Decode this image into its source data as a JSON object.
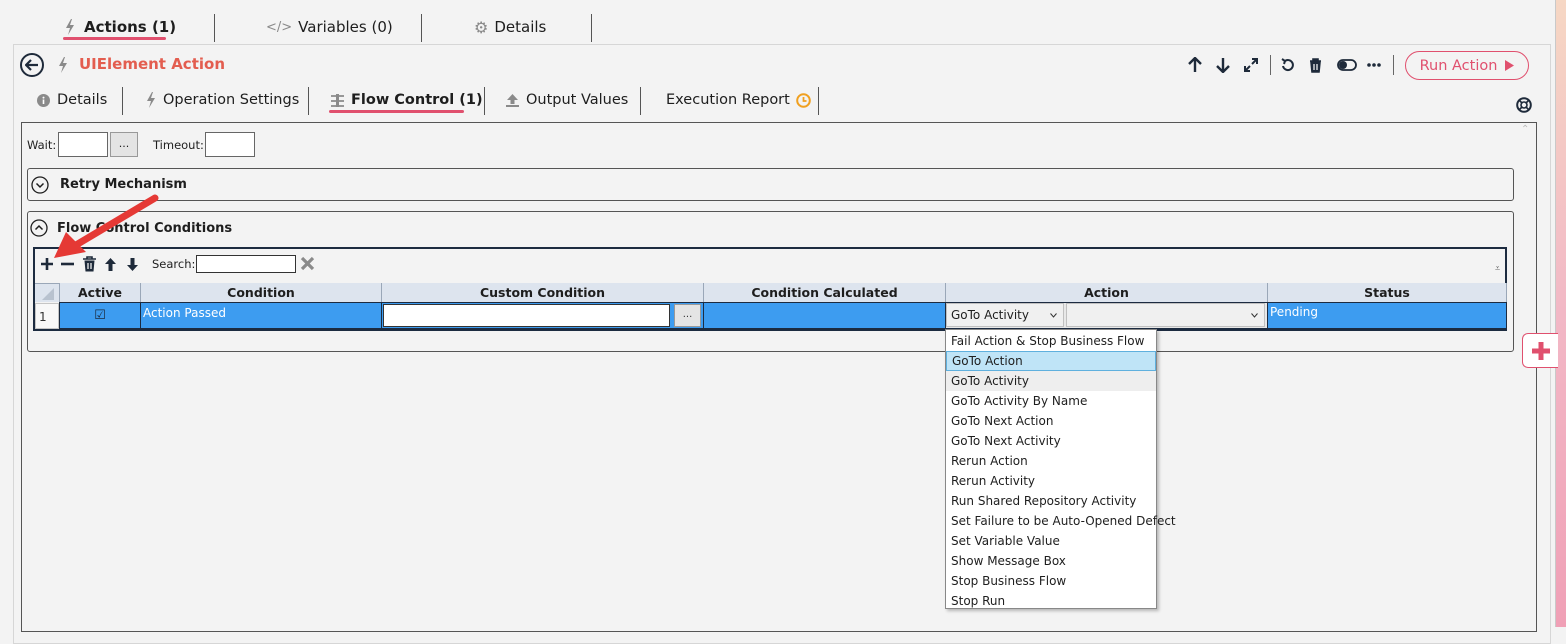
{
  "top_tabs": [
    {
      "label": "Actions (1)"
    },
    {
      "label": "Variables (0)"
    },
    {
      "label": "Details"
    }
  ],
  "header": {
    "title": "UIElement Action",
    "run_button": "Run Action"
  },
  "sub_tabs": [
    {
      "label": "Details"
    },
    {
      "label": "Operation Settings"
    },
    {
      "label": "Flow Control (1)"
    },
    {
      "label": "Output Values"
    },
    {
      "label": "Execution Report"
    }
  ],
  "wait": {
    "label": "Wait:",
    "value": "",
    "browse": "..."
  },
  "timeout": {
    "label": "Timeout:",
    "value": ""
  },
  "sections": {
    "retry": "Retry Mechanism",
    "flow": "Flow Control Conditions"
  },
  "grid": {
    "search_label": "Search:",
    "search_value": "",
    "columns": [
      "Active",
      "Condition",
      "Custom Condition",
      "Condition Calculated",
      "Action",
      "Status"
    ],
    "rows": [
      {
        "index": "1",
        "active": "☑",
        "condition": "Action Passed",
        "custom_condition": "",
        "browse": "...",
        "calculated": "",
        "action": "GoTo Activity",
        "action_value": "",
        "status": "Pending"
      }
    ]
  },
  "dropdown": {
    "options": [
      "Fail Action & Stop Business Flow",
      "GoTo Action",
      "GoTo Activity",
      "GoTo Activity By Name",
      "GoTo Next Action",
      "GoTo Next Activity",
      "Rerun Action",
      "Rerun Activity",
      "Run Shared Repository Activity",
      "Set Failure to be Auto-Opened Defect",
      "Set Variable Value",
      "Show Message Box",
      "Stop Business Flow",
      "Stop Run"
    ],
    "highlighted": "GoTo Action",
    "selected": "GoTo Activity"
  },
  "colors": {
    "accent": "#e0506e",
    "title": "#e35d4f",
    "selection": "#3d9cf0",
    "annotation_arrow": "#e53935"
  },
  "icons": [
    "lightning-icon",
    "code-icon",
    "gear-icon",
    "back-arrow-icon",
    "arrow-up-icon",
    "arrow-down-icon",
    "expand-icon",
    "undo-icon",
    "trash-icon",
    "toggle-icon",
    "more-icon",
    "play-icon",
    "info-icon",
    "flow-icon",
    "upload-icon",
    "clock-icon",
    "help-ring-icon",
    "chevron-down-circle-icon",
    "chevron-up-circle-icon",
    "plus-icon",
    "minus-icon",
    "close-x-icon",
    "side-add-icon"
  ]
}
